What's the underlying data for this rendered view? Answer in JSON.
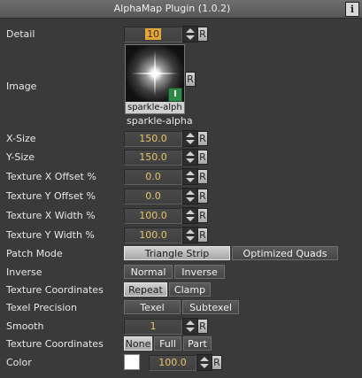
{
  "window": {
    "title": "AlphaMap Plugin (1.0.2)",
    "info_label": "i"
  },
  "rows": {
    "detail": {
      "label": "Detail",
      "value": "10",
      "reset": "R"
    },
    "image": {
      "label": "Image",
      "thumb_caption": "sparkle-alph",
      "badge": "I",
      "name": "sparkle-alpha",
      "reset": "R"
    },
    "x_size": {
      "label": "X-Size",
      "value": "150.0",
      "reset": "R"
    },
    "y_size": {
      "label": "Y-Size",
      "value": "150.0",
      "reset": "R"
    },
    "tex_x_offset": {
      "label": "Texture X Offset %",
      "value": "0.0",
      "reset": "R"
    },
    "tex_y_offset": {
      "label": "Texture Y Offset %",
      "value": "0.0",
      "reset": "R"
    },
    "tex_x_width": {
      "label": "Texture X Width %",
      "value": "100.0",
      "reset": "R"
    },
    "tex_y_width": {
      "label": "Texture Y Width %",
      "value": "100.0",
      "reset": "R"
    },
    "patch_mode": {
      "label": "Patch Mode",
      "options": [
        "Triangle Strip",
        "Optimized Quads"
      ],
      "selected": "Triangle Strip"
    },
    "inverse": {
      "label": "Inverse",
      "options": [
        "Normal",
        "Inverse"
      ],
      "selected": "Normal"
    },
    "tex_coords_wrap": {
      "label": "Texture Coordinates",
      "options": [
        "Repeat",
        "Clamp"
      ],
      "selected": "Repeat"
    },
    "texel_precision": {
      "label": "Texel Precision",
      "options": [
        "Texel",
        "Subtexel"
      ],
      "selected": "Texel"
    },
    "smooth": {
      "label": "Smooth",
      "value": "1",
      "reset": "R"
    },
    "tex_coords_mode": {
      "label": "Texture Coordinates",
      "options": [
        "None",
        "Full",
        "Part"
      ],
      "selected": "None"
    },
    "color": {
      "label": "Color",
      "swatch": "#ffffff",
      "value": "100.0",
      "reset": "R"
    }
  },
  "colors": {
    "value_text": "#e9c46a",
    "highlight": "#e3a634",
    "background": "#3a3a3a"
  }
}
